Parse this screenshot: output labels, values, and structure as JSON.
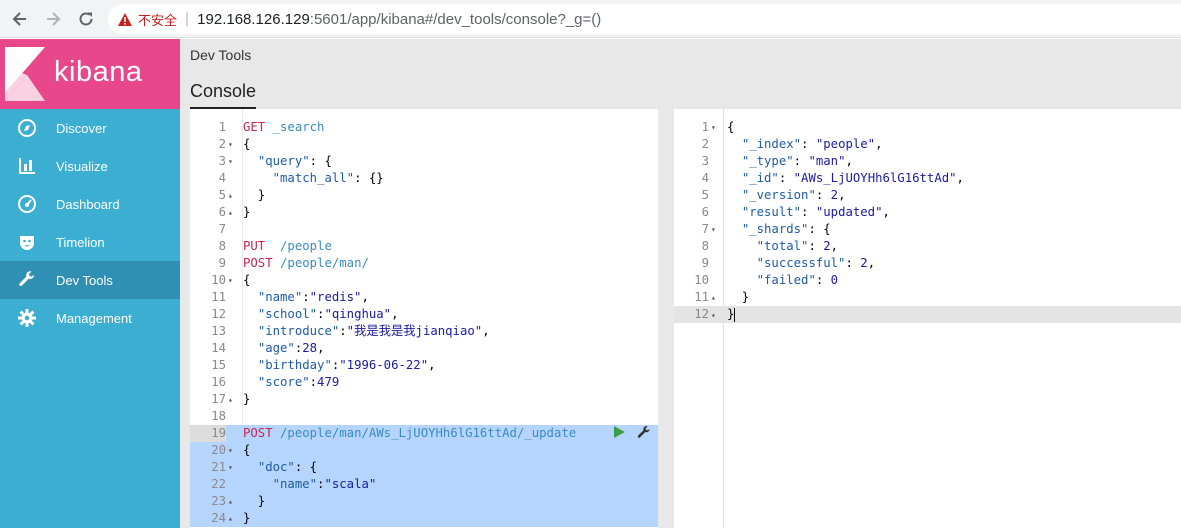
{
  "browser": {
    "insecure_label": "不安全",
    "url_host": "192.168.126.129",
    "url_rest": ":5601/app/kibana#/dev_tools/console?_g=()"
  },
  "sidebar": {
    "logo_text": "kibana",
    "items": [
      {
        "label": "Discover",
        "icon": "compass-icon"
      },
      {
        "label": "Visualize",
        "icon": "bar-chart-icon"
      },
      {
        "label": "Dashboard",
        "icon": "dashboard-icon"
      },
      {
        "label": "Timelion",
        "icon": "timelion-icon"
      },
      {
        "label": "Dev Tools",
        "icon": "wrench-icon",
        "active": true
      },
      {
        "label": "Management",
        "icon": "gear-icon"
      }
    ]
  },
  "main": {
    "app_title": "Dev Tools",
    "tab_label": "Console"
  },
  "editor": {
    "lines": [
      {
        "n": "1",
        "html": "<span class='method'>GET</span> <span class='url'>_search</span>"
      },
      {
        "n": "2",
        "fold": "▾",
        "html": "<span class='punc'>{</span>"
      },
      {
        "n": "3",
        "fold": "▾",
        "html": "  <span class='key'>\"query\"</span>: {"
      },
      {
        "n": "4",
        "html": "    <span class='key'>\"match_all\"</span>: {}"
      },
      {
        "n": "5",
        "fold": "▴",
        "html": "  }"
      },
      {
        "n": "6",
        "fold": "▴",
        "html": "}"
      },
      {
        "n": "7",
        "html": ""
      },
      {
        "n": "8",
        "html": "<span class='method'>PUT</span>  <span class='url'>/people</span>"
      },
      {
        "n": "9",
        "html": "<span class='method'>POST</span> <span class='url'>/people/man/</span>"
      },
      {
        "n": "10",
        "fold": "▾",
        "html": "{"
      },
      {
        "n": "11",
        "html": "  <span class='key'>\"name\"</span>:<span class='str'>\"redis\"</span>,"
      },
      {
        "n": "12",
        "html": "  <span class='key'>\"school\"</span>:<span class='str'>\"qinghua\"</span>,"
      },
      {
        "n": "13",
        "html": "  <span class='key'>\"introduce\"</span>:<span class='str'>\"我是我是我jianqiao\"</span>,"
      },
      {
        "n": "14",
        "html": "  <span class='key'>\"age\"</span>:<span class='num'>28</span>,"
      },
      {
        "n": "15",
        "html": "  <span class='key'>\"birthday\"</span>:<span class='str'>\"1996-06-22\"</span>,"
      },
      {
        "n": "16",
        "html": "  <span class='key'>\"score\"</span>:<span class='num'>479</span>"
      },
      {
        "n": "17",
        "fold": "▴",
        "html": "}"
      },
      {
        "n": "18",
        "html": ""
      },
      {
        "n": "19",
        "sel": true,
        "gutsel": true,
        "html": "<span class='method'>POST</span> <span class='url'>/people/man/AWs_LjUOYHh6lG16ttAd/_update</span>"
      },
      {
        "n": "20",
        "fold": "▾",
        "sel": true,
        "html": "{"
      },
      {
        "n": "21",
        "fold": "▾",
        "sel": true,
        "html": "  <span class='key'>\"doc\"</span>: {"
      },
      {
        "n": "22",
        "sel": true,
        "html": "    <span class='key'>\"name\"</span>:<span class='str'>\"scala\"</span>"
      },
      {
        "n": "23",
        "fold": "▴",
        "sel": true,
        "html": "  }"
      },
      {
        "n": "24",
        "fold": "▴",
        "sel": true,
        "html": "}"
      }
    ]
  },
  "output": {
    "lines": [
      {
        "n": "1",
        "fold": "▾",
        "html": "{"
      },
      {
        "n": "2",
        "html": "  <span class='key'>\"_index\"</span>: <span class='str'>\"people\"</span>,"
      },
      {
        "n": "3",
        "html": "  <span class='key'>\"_type\"</span>: <span class='str'>\"man\"</span>,"
      },
      {
        "n": "4",
        "html": "  <span class='key'>\"_id\"</span>: <span class='str'>\"AWs_LjUOYHh6lG16ttAd\"</span>,"
      },
      {
        "n": "5",
        "html": "  <span class='key'>\"_version\"</span>: <span class='num'>2</span>,"
      },
      {
        "n": "6",
        "html": "  <span class='key'>\"result\"</span>: <span class='str'>\"updated\"</span>,"
      },
      {
        "n": "7",
        "fold": "▾",
        "html": "  <span class='key'>\"_shards\"</span>: {"
      },
      {
        "n": "8",
        "html": "    <span class='key'>\"total\"</span>: <span class='num'>2</span>,"
      },
      {
        "n": "9",
        "html": "    <span class='key'>\"successful\"</span>: <span class='num'>2</span>,"
      },
      {
        "n": "10",
        "html": "    <span class='key'>\"failed\"</span>: <span class='num'>0</span>"
      },
      {
        "n": "11",
        "fold": "▴",
        "html": "  }"
      },
      {
        "n": "12",
        "fold": "▴",
        "active": true,
        "html": "}<span class='cursor'></span>"
      }
    ]
  }
}
